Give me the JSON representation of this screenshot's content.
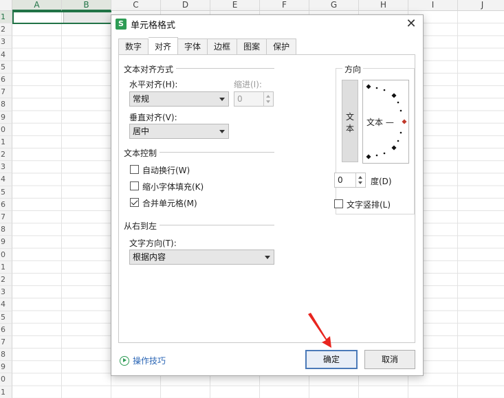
{
  "sheet": {
    "columns": [
      "A",
      "B",
      "C",
      "D",
      "E",
      "F",
      "G",
      "H",
      "I",
      "J"
    ],
    "rows": [
      "1",
      "2",
      "3",
      "4",
      "5",
      "6",
      "7",
      "8",
      "9",
      "0",
      "1",
      "2",
      "3",
      "4",
      "5",
      "6",
      "7",
      "8",
      "9",
      "0",
      "1",
      "2",
      "3",
      "4",
      "5",
      "6",
      "7",
      "8",
      "9",
      "0",
      "1"
    ]
  },
  "dialog": {
    "app_icon": "S",
    "title": "单元格格式",
    "close_glyph": "✕",
    "tabs": [
      {
        "label": "数字",
        "active": false
      },
      {
        "label": "对齐",
        "active": true
      },
      {
        "label": "字体",
        "active": false
      },
      {
        "label": "边框",
        "active": false
      },
      {
        "label": "图案",
        "active": false
      },
      {
        "label": "保护",
        "active": false
      }
    ],
    "text_alignment": {
      "group_title": "文本对齐方式",
      "horizontal_label": "水平对齐(H):",
      "horizontal_value": "常规",
      "indent_label": "缩进(I):",
      "indent_value": "0",
      "vertical_label": "垂直对齐(V):",
      "vertical_value": "居中"
    },
    "text_control": {
      "group_title": "文本控制",
      "wrap_text": {
        "label": "自动换行(W)",
        "checked": false
      },
      "shrink_to_fit": {
        "label": "缩小字体填充(K)",
        "checked": false
      },
      "merge_cells": {
        "label": "合并单元格(M)",
        "checked": true
      }
    },
    "rtl": {
      "group_title": "从右到左",
      "direction_label": "文字方向(T):",
      "direction_value": "根据内容"
    },
    "orientation": {
      "group_title": "方向",
      "vertical_text": "文本",
      "dial_text": "文本 —",
      "degree_value": "0",
      "degree_label": "度(D)",
      "vertical_checkbox": {
        "label": "文字竖排(L)",
        "checked": false
      }
    },
    "footer": {
      "tips_label": "操作技巧",
      "ok_label": "确定",
      "cancel_label": "取消"
    }
  },
  "colors": {
    "accent_green": "#217346",
    "ok_border": "#4a79b8",
    "annotation_red": "#e8251f",
    "dial_marker": "#c0392b"
  }
}
